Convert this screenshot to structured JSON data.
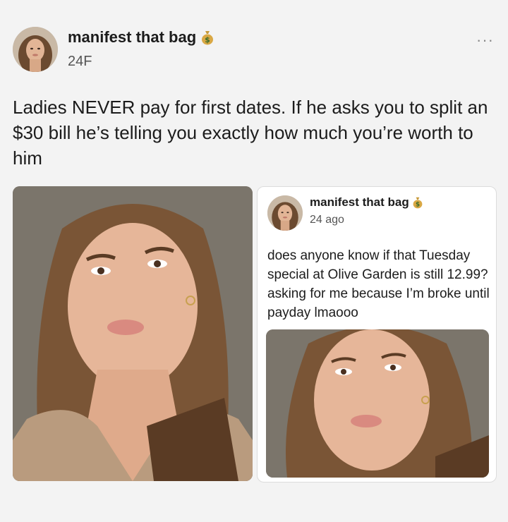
{
  "post": {
    "username": "manifest that bag",
    "badge_icon": "money-bag-icon",
    "handle": "24F",
    "more_icon": "more-options-icon",
    "more_label": "···",
    "text": "Ladies NEVER pay for first dates. If he asks you to split an $30 bill he’s telling you exactly how much you’re worth to him",
    "image_icon": "selfie-photo"
  },
  "quote": {
    "username": "manifest that bag",
    "badge_icon": "money-bag-icon",
    "handle": "24 ago",
    "text": "does anyone know if that Tuesday special at Olive Garden is still 12.99? asking for me because I’m broke until payday lmaooo",
    "image_icon": "selfie-photo"
  },
  "colors": {
    "background": "#f3f3f3",
    "card": "#ffffff",
    "text": "#1c1c1c",
    "muted": "#555555"
  }
}
